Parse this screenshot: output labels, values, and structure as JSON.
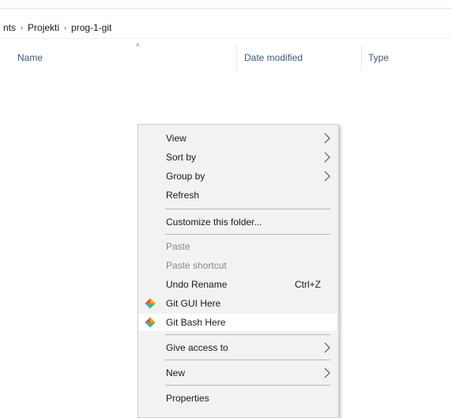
{
  "breadcrumb": {
    "items": [
      "nts",
      "Projekti",
      "prog-1-git"
    ],
    "separator": "›"
  },
  "columns": {
    "name": "Name",
    "date_modified": "Date modified",
    "type": "Type",
    "sort_indicator": "^"
  },
  "context_menu": {
    "view": "View",
    "sort_by": "Sort by",
    "group_by": "Group by",
    "refresh": "Refresh",
    "customize": "Customize this folder...",
    "paste": "Paste",
    "paste_shortcut": "Paste shortcut",
    "undo_rename": "Undo Rename",
    "undo_rename_shortcut": "Ctrl+Z",
    "git_gui": "Git GUI Here",
    "git_bash": "Git Bash Here",
    "give_access": "Give access to",
    "new": "New",
    "properties": "Properties"
  },
  "colors": {
    "menu_bg": "#f2f2f2",
    "hover_bg": "#ffffff",
    "git_orange": "#f05032",
    "git_blue": "#3fa7e0"
  },
  "icons": {
    "submenu": "chevron-right-icon",
    "git": "git-icon",
    "sort": "caret-up-icon"
  }
}
